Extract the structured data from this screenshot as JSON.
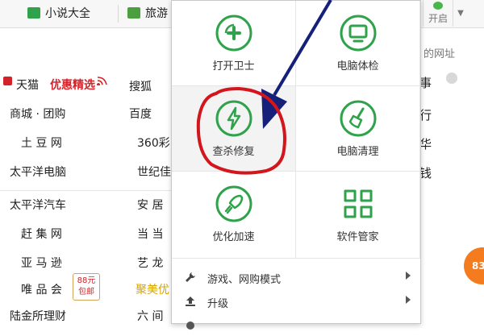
{
  "toolbar": {
    "tabs": [
      {
        "label": "小说大全",
        "icon": "book-icon"
      },
      {
        "label": "旅游",
        "icon": "travel-icon"
      }
    ],
    "open_label": "开启",
    "dropdown_icon": "triangle-down-icon"
  },
  "address_hint": "的网址",
  "right_column": [
    "事",
    "行",
    "华",
    "钱"
  ],
  "site_list": {
    "rows": [
      {
        "col1": "天猫",
        "col1b": "优惠精选",
        "col2": "搜狐"
      },
      {
        "col1": "商城 · 团购",
        "col2": "百度"
      },
      {
        "col1": "土 豆 网",
        "col2": "360彩"
      },
      {
        "col1": "太平洋电脑",
        "col2": "世纪佳"
      },
      {
        "col1": "太平洋汽车",
        "col2": "安 居"
      },
      {
        "col1": "赶 集 网",
        "col2": "当 当"
      },
      {
        "col1": "亚 马 逊",
        "col2": "艺 龙"
      },
      {
        "col1": "唯 品 会",
        "col2": "聚美优"
      },
      {
        "col1": "陆金所理财",
        "col2": "六 间"
      }
    ],
    "badge": [
      "88元",
      "包邮"
    ]
  },
  "bubble_text": "83",
  "security_panel": {
    "grid": [
      {
        "label": "打开卫士",
        "icon": "shield-plus-icon"
      },
      {
        "label": "电脑体检",
        "icon": "monitor-icon"
      },
      {
        "label": "查杀修复",
        "icon": "lightning-icon"
      },
      {
        "label": "电脑清理",
        "icon": "broom-icon"
      },
      {
        "label": "优化加速",
        "icon": "rocket-icon"
      },
      {
        "label": "软件管家",
        "icon": "software-grid-icon"
      }
    ],
    "menu": [
      {
        "label": "游戏、网购模式",
        "icon": "wrench-icon"
      },
      {
        "label": "升级",
        "icon": "upload-icon"
      }
    ]
  },
  "colors": {
    "accent_green": "#2fa24b",
    "annotation_red": "#d2161c",
    "arrow_blue": "#14207a"
  }
}
